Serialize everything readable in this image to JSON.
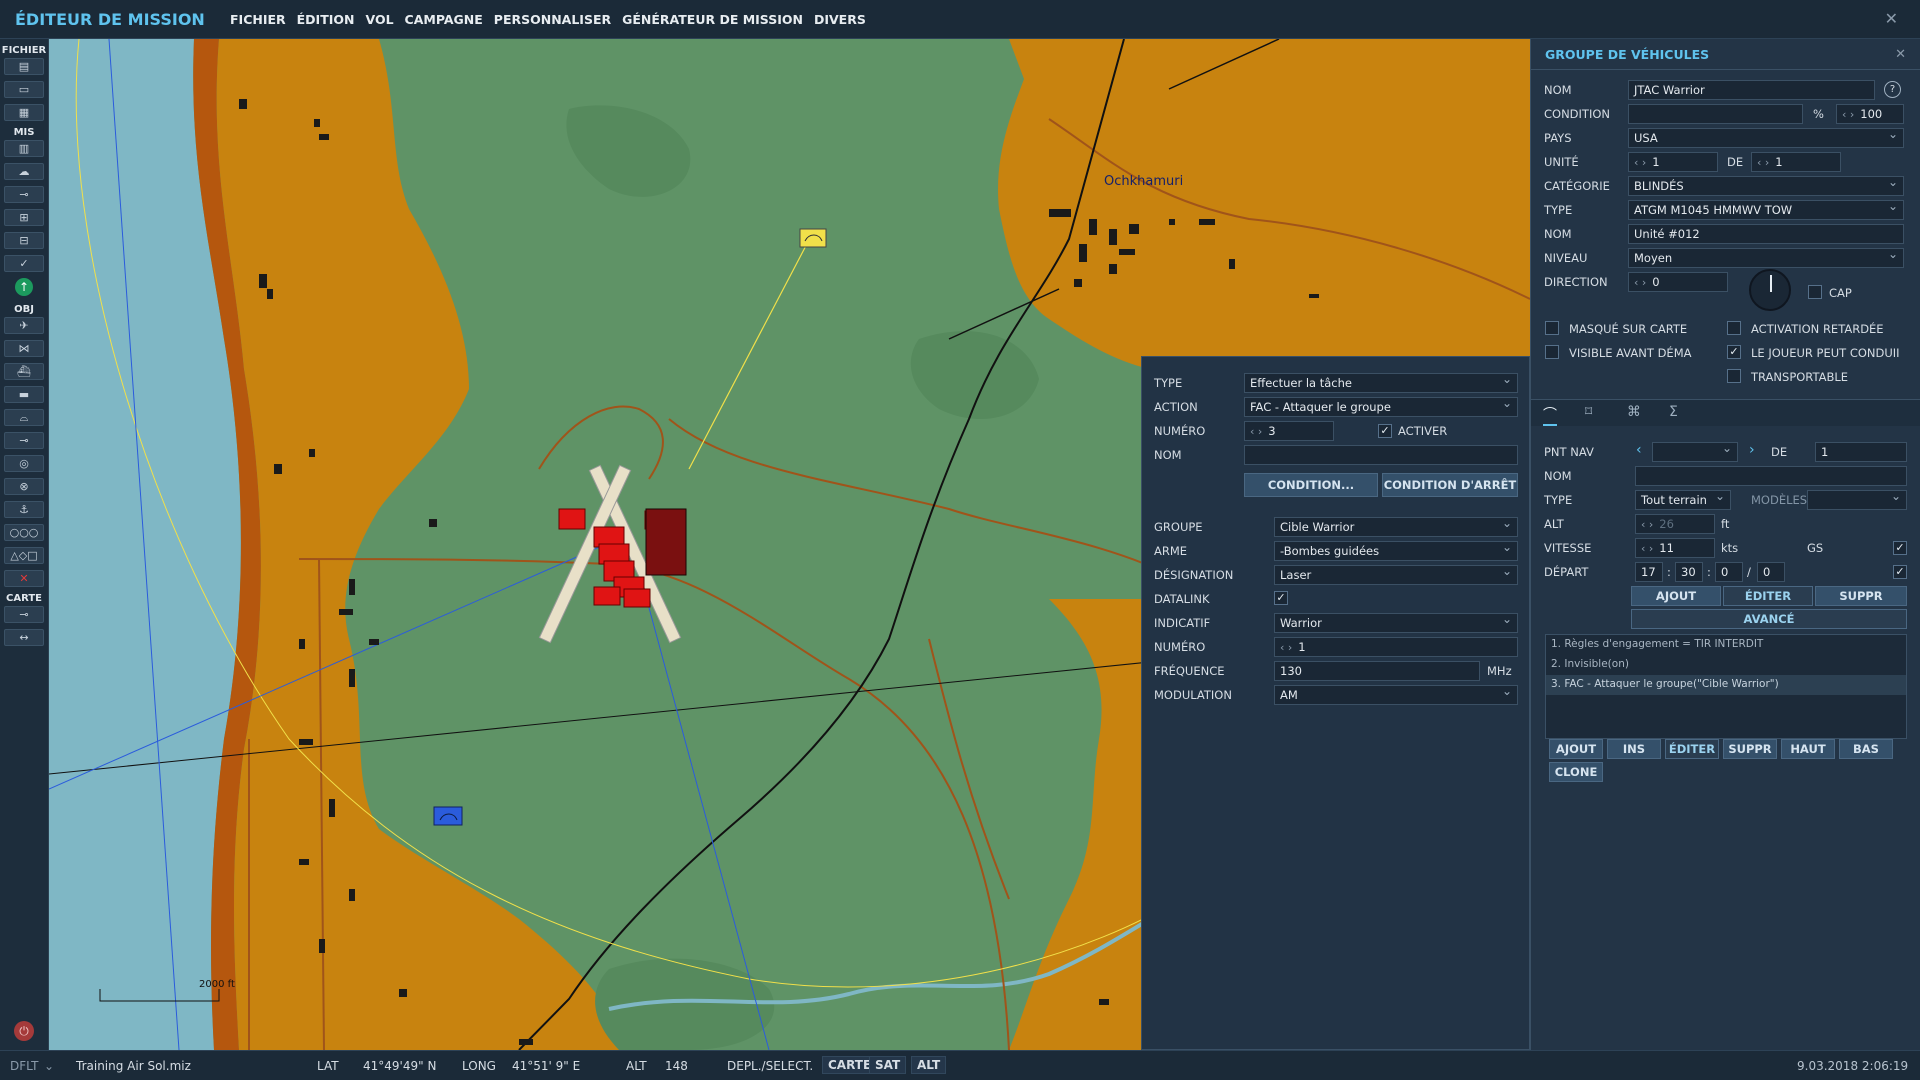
{
  "app_title": "ÉDITEUR DE MISSION",
  "menu": [
    "FICHIER",
    "ÉDITION",
    "VOL",
    "CAMPAGNE",
    "PERSONNALISER",
    "GÉNÉRATEUR DE MISSION",
    "DIVERS"
  ],
  "toolbar": {
    "section_file": "FICHIER",
    "section_mis": "MIS",
    "section_obj": "OBJ",
    "section_map": "CARTE"
  },
  "map": {
    "town_label": "Ochkhamuri",
    "scale_label": "2000 ft"
  },
  "status": {
    "mode": "DFLT",
    "file": "Training Air Sol.miz",
    "lat_label": "LAT",
    "lat": "41°49'49\" N",
    "long_label": "LONG",
    "long": "41°51' 9\" E",
    "alt_label": "ALT",
    "alt": "148",
    "move_label": "DEPL./SELECT.",
    "btn_map": "CARTE",
    "btn_sat": "SAT",
    "btn_alt": "ALT",
    "datetime": "9.03.2018 2:06:19"
  },
  "group": {
    "title": "GROUPE DE VÉHICULES",
    "name_label": "NOM",
    "name": "JTAC Warrior",
    "condition_label": "CONDITION",
    "condition_pct": "%",
    "condition_val": "100",
    "country_label": "PAYS",
    "country": "USA",
    "unit_label": "UNITÉ",
    "unit": "1",
    "of_label": "DE",
    "unit_of": "1",
    "category_label": "CATÉGORIE",
    "category": "BLINDÉS",
    "type_label": "TYPE",
    "type": "ATGM M1045 HMMWV TOW",
    "unit_name_label": "NOM",
    "unit_name": "Unité #012",
    "level_label": "NIVEAU",
    "level": "Moyen",
    "heading_label": "DIRECTION",
    "heading": "0",
    "cap_label": "CAP",
    "hidden_label": "MASQUÉ SUR CARTE",
    "delayed_label": "ACTIVATION RETARDÉE",
    "visible_label": "VISIBLE AVANT DÉMA",
    "player_drive_label": "LE JOUEUR PEUT CONDUII",
    "transportable_label": "TRANSPORTABLE"
  },
  "waypoint": {
    "wp_label": "PNT NAV",
    "of_label": "DE",
    "of": "1",
    "name_label": "NOM",
    "type_label": "TYPE",
    "type": "Tout terrain",
    "models_label": "MODÈLES",
    "alt_label": "ALT",
    "alt": "26",
    "alt_unit": "ft",
    "speed_label": "VITESSE",
    "speed": "11",
    "speed_unit": "kts",
    "gs_label": "GS",
    "depart_label": "DÉPART",
    "dep_h": "17",
    "dep_m": "30",
    "dep_s": "0",
    "dep_d": "0",
    "btn_add": "AJOUT",
    "btn_edit": "ÉDITER",
    "btn_del": "SUPPR",
    "btn_adv": "AVANCÉ"
  },
  "actions": [
    "1. Règles d'engagement = TIR INTERDIT",
    "2. Invisible(on)",
    "3. FAC - Attaquer le groupe(\"Cible Warrior\")"
  ],
  "action_buttons": [
    "AJOUT",
    "INS",
    "ÉDITER",
    "SUPPR",
    "HAUT",
    "BAS",
    "CLONE"
  ],
  "task": {
    "type_label": "TYPE",
    "type": "Effectuer la tâche",
    "action_label": "ACTION",
    "action": "FAC - Attaquer le groupe",
    "number_label": "NUMÉRO",
    "number": "3",
    "activate_label": "ACTIVER",
    "name_label": "NOM",
    "btn_condition": "CONDITION...",
    "btn_stop": "CONDITION D'ARRÊT",
    "group_label": "GROUPE",
    "group": "Cible Warrior",
    "weapon_label": "ARME",
    "weapon": "-Bombes guidées",
    "designation_label": "DÉSIGNATION",
    "designation": "Laser",
    "datalink_label": "DATALINK",
    "callsign_label": "INDICATIF",
    "callsign": "Warrior",
    "cs_number_label": "NUMÉRO",
    "cs_number": "1",
    "freq_label": "FRÉQUENCE",
    "freq": "130",
    "freq_unit": "MHz",
    "modulation_label": "MODULATION",
    "modulation": "AM"
  },
  "colors": {
    "accent": "#5fc3ee",
    "map_green": "#5f9366",
    "map_orange": "#c8830f",
    "sea": "#7fb7c5",
    "red_units": "#e01414"
  }
}
